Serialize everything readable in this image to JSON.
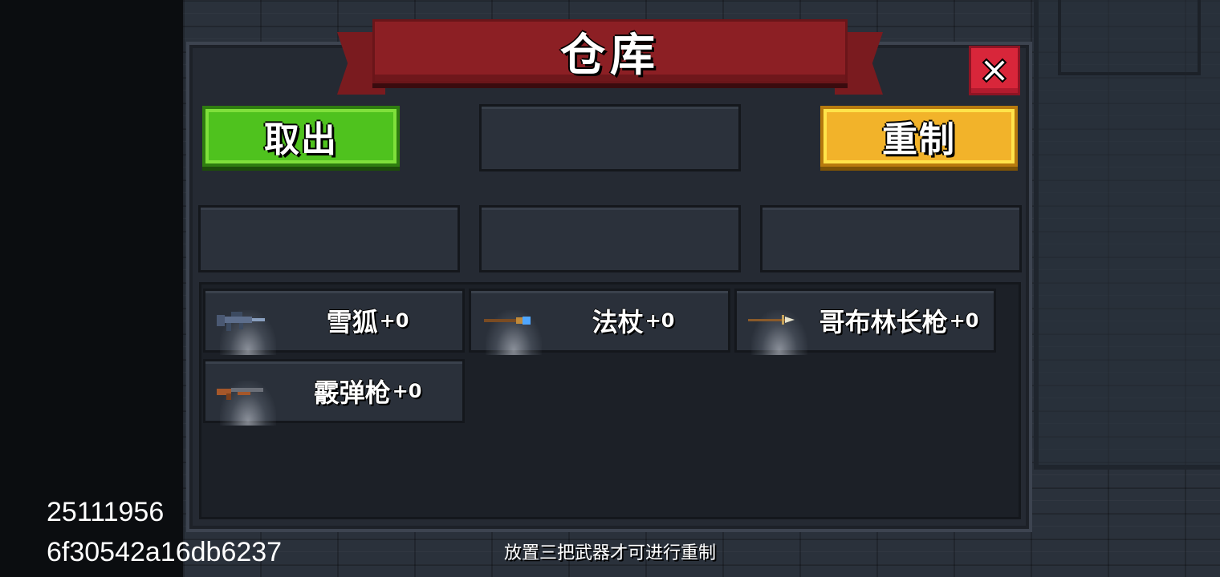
{
  "title": "仓库",
  "buttons": {
    "take": "取出",
    "remake": "重制"
  },
  "items": [
    {
      "name": "雪狐",
      "level": "+0",
      "icon": "rifle-icon"
    },
    {
      "name": "法杖",
      "level": "+0",
      "icon": "staff-icon"
    },
    {
      "name": "哥布林长枪",
      "level": "+0",
      "icon": "spear-icon"
    },
    {
      "name": "霰弹枪",
      "level": "+0",
      "icon": "shotgun-icon"
    }
  ],
  "hint": "放置三把武器才可进行重制",
  "debug": {
    "line1": "25111956",
    "line2": "6f30542a16db6237"
  },
  "colors": {
    "banner": "#8c1f24",
    "take_button": "#4fc21e",
    "remake_button": "#f2b32a",
    "close_button": "#d8263a"
  }
}
